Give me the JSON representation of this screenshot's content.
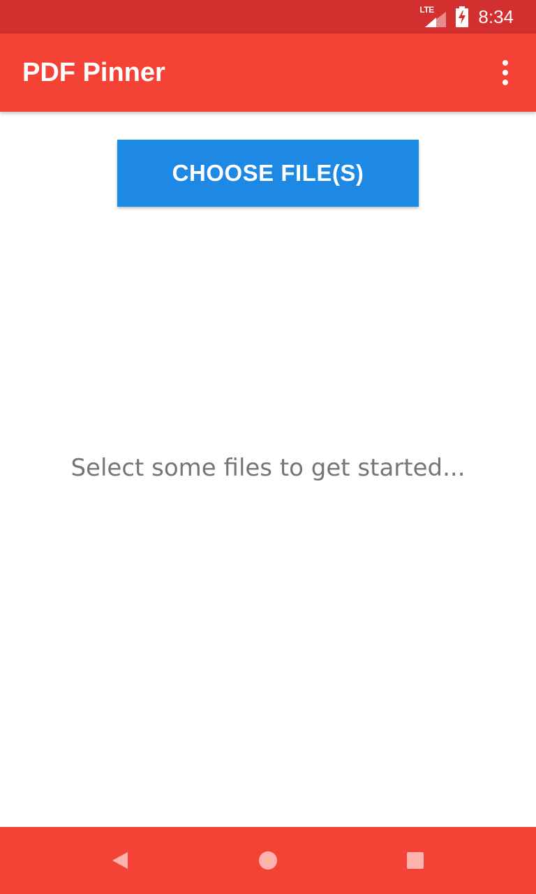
{
  "status_bar": {
    "network_label": "LTE",
    "time": "8:34",
    "icons": [
      "lte-signal-icon",
      "battery-charging-icon"
    ]
  },
  "app_bar": {
    "title": "PDF Pinner",
    "overflow_icon": "more-vert-icon"
  },
  "main": {
    "choose_button_label": "CHOOSE FILE(S)",
    "empty_message": "Select some files to get started..."
  },
  "nav_bar": {
    "icons": [
      "back-icon",
      "home-icon",
      "recents-icon"
    ]
  },
  "colors": {
    "status_bar": "#d32f2f",
    "app_bar": "#f44336",
    "primary_button": "#1e88e5",
    "nav_bar": "#f44336",
    "empty_text": "#757575"
  }
}
